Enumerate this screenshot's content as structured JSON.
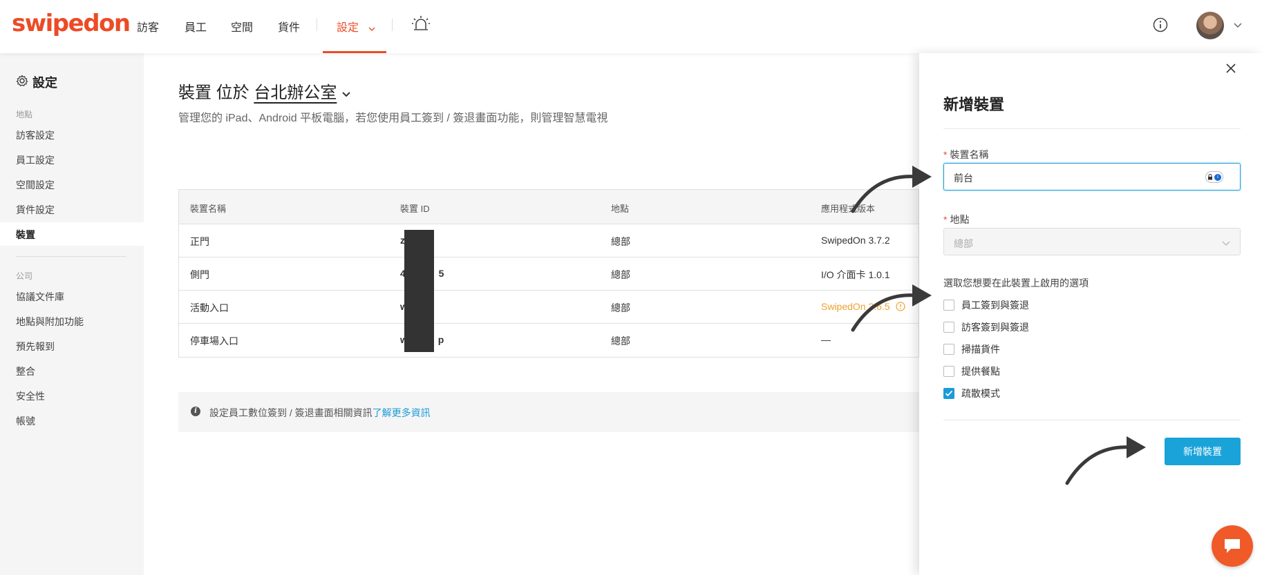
{
  "brand": {
    "logo": "swipedon",
    "accent": "#ec4b26",
    "link_color": "#1a9bd8"
  },
  "topnav": {
    "items": [
      "訪客",
      "員工",
      "空間",
      "貨件",
      "設定"
    ],
    "active": "設定"
  },
  "sidebar": {
    "title": "設定",
    "sections": [
      {
        "heading": "地點",
        "items": [
          "訪客設定",
          "員工設定",
          "空間設定",
          "貨件設定",
          "裝置"
        ]
      },
      {
        "heading": "公司",
        "items": [
          "協議文件庫",
          "地點與附加功能",
          "預先報到",
          "整合",
          "安全性",
          "帳號"
        ]
      }
    ],
    "active_item": "裝置"
  },
  "main": {
    "title_prefix": "裝置 位於",
    "location": "台北辦公室",
    "description": "管理您的 iPad、Android 平板電腦，若您使用員工簽到 / 簽退畫面功能，則管理智慧電視",
    "table": {
      "headers": [
        "裝置名稱",
        "裝置 ID",
        "地點",
        "應用程式版本"
      ],
      "rows": [
        [
          "正門",
          "z",
          "總部",
          "SwipedOn 3.7.2"
        ],
        [
          "側門",
          "4 5",
          "總部",
          "I/O 介面卡 1.0.1"
        ],
        [
          "活動入口",
          "w",
          "總部",
          "SwipedOn 3.6.5"
        ],
        [
          "停車場入口",
          "w p",
          "總部",
          "—"
        ]
      ]
    },
    "info": {
      "text": "設定員工數位簽到 / 簽退畫面相關資訊",
      "link": "了解更多資訊"
    }
  },
  "drawer": {
    "title": "新增裝置",
    "name_label": "裝置名稱",
    "name_value": "前台",
    "location_label": "地點",
    "location_value": "總部",
    "options_label": "選取您想要在此裝置上啟用的選項",
    "options": [
      {
        "label": "員工簽到與簽退",
        "checked": false
      },
      {
        "label": "訪客簽到與簽退",
        "checked": false
      },
      {
        "label": "掃描貨件",
        "checked": false
      },
      {
        "label": "提供餐點",
        "checked": false
      },
      {
        "label": "疏散模式",
        "checked": true
      }
    ],
    "submit": "新增裝置"
  },
  "icons": {
    "alarm": "alarm-light-icon",
    "info": "info-icon",
    "settings": "gear-icon",
    "close": "close-icon",
    "chat": "chat-icon",
    "password_manager": "password-manager-icon"
  }
}
